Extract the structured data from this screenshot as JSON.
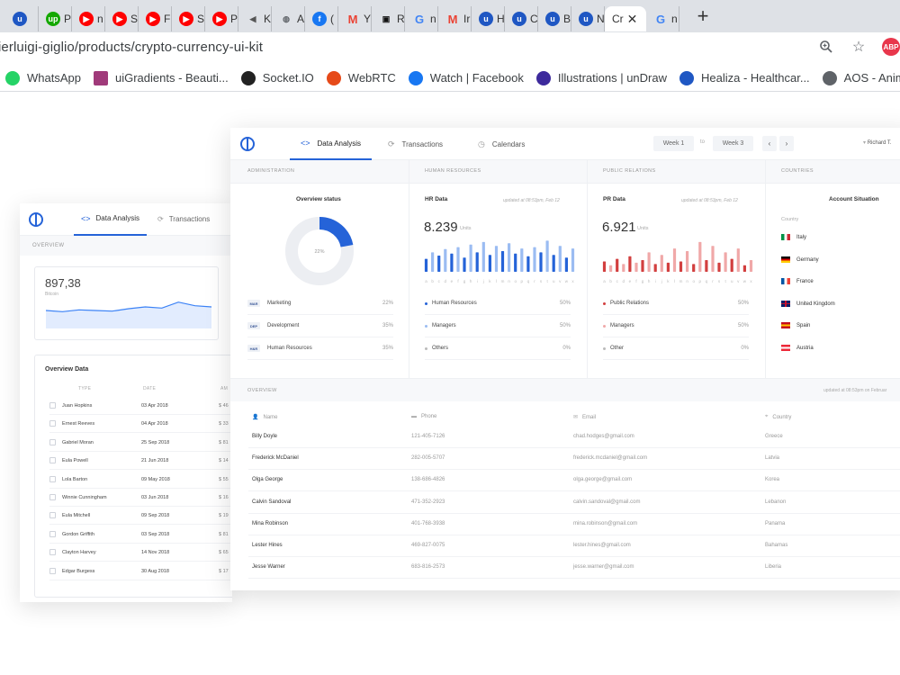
{
  "browser": {
    "tabs": [
      {
        "icon": "ui",
        "label": "",
        "color": "#1f57c3"
      },
      {
        "icon": "up",
        "label": "P",
        "color": "#14a800"
      },
      {
        "icon": "yt",
        "label": "n",
        "color": "#ff0000"
      },
      {
        "icon": "yt",
        "label": "S",
        "color": "#ff0000"
      },
      {
        "icon": "yt",
        "label": "F",
        "color": "#ff0000"
      },
      {
        "icon": "yt",
        "label": "S",
        "color": "#ff0000"
      },
      {
        "icon": "yt",
        "label": "P",
        "color": "#ff0000"
      },
      {
        "icon": "mute",
        "label": "Ki",
        "color": "#555555"
      },
      {
        "icon": "globe",
        "label": "A",
        "color": "#5f6368"
      },
      {
        "icon": "fb",
        "label": "(",
        "color": "#1877f2"
      },
      {
        "icon": "gm",
        "label": "Y",
        "color": "#ea4335"
      },
      {
        "icon": "qr",
        "label": "R",
        "color": "#111111"
      },
      {
        "icon": "g",
        "label": "n",
        "color": "#4285f4"
      },
      {
        "icon": "gm",
        "label": "Ir",
        "color": "#ea4335"
      },
      {
        "icon": "ui",
        "label": "H",
        "color": "#1f57c3"
      },
      {
        "icon": "ui",
        "label": "C",
        "color": "#1f57c3"
      },
      {
        "icon": "ui",
        "label": "B",
        "color": "#1f57c3"
      },
      {
        "icon": "ui",
        "label": "N",
        "color": "#1f57c3"
      }
    ],
    "active_tab": {
      "label": "Cr"
    },
    "last_tab": {
      "icon": "g",
      "label": "n",
      "color": "#4285f4"
    },
    "new_tab_label": "+",
    "url": "ierluigi-giglio/products/crypto-currency-ui-kit",
    "extension_badge": "ABP",
    "bookmarks": [
      {
        "label": "WhatsApp",
        "color": "#25d366"
      },
      {
        "label": "uiGradients - Beauti...",
        "color": "#a03a7a"
      },
      {
        "label": "Socket.IO",
        "color": "#222222"
      },
      {
        "label": "WebRTC",
        "color": "#e64a19"
      },
      {
        "label": "Watch | Facebook",
        "color": "#1877f2"
      },
      {
        "label": "Illustrations | unDraw",
        "color": "#3d2a9c"
      },
      {
        "label": "Healiza - Healthcar...",
        "color": "#1f57c3"
      },
      {
        "label": "AOS - Animate",
        "color": "#5f6368"
      }
    ]
  },
  "back_card": {
    "tabs": [
      {
        "label": "Data Analysis"
      },
      {
        "label": "Transactions"
      }
    ],
    "section": "OVERVIEW",
    "big_value": "897,38",
    "big_sub": "Bitcoin",
    "table_title": "Overview Data",
    "headers": [
      "TYPE",
      "DATE",
      "AM"
    ],
    "rows": [
      {
        "name": "Juan Hopkins",
        "date": "03 Apr 2018",
        "amount": "$ 46"
      },
      {
        "name": "Ernest Reeves",
        "date": "04 Apr 2018",
        "amount": "$ 33"
      },
      {
        "name": "Gabriel Moran",
        "date": "25 Sep 2018",
        "amount": "$ 81"
      },
      {
        "name": "Eula Powell",
        "date": "21 Jun 2018",
        "amount": "$ 14"
      },
      {
        "name": "Lola Barton",
        "date": "09 May 2018",
        "amount": "$ 55"
      },
      {
        "name": "Winnie Cunningham",
        "date": "03 Jun 2018",
        "amount": "$ 16"
      },
      {
        "name": "Eula Mitchell",
        "date": "09 Sep 2018",
        "amount": "$ 19"
      },
      {
        "name": "Gordon Griffith",
        "date": "03 Sep 2018",
        "amount": "$ 81"
      },
      {
        "name": "Clayton Harvey",
        "date": "14 Nov 2018",
        "amount": "$ 65"
      },
      {
        "name": "Edgar Burgess",
        "date": "30 Aug 2018",
        "amount": "$ 17"
      }
    ]
  },
  "front_card": {
    "tabs": [
      {
        "label": "Data Analysis"
      },
      {
        "label": "Transactions"
      },
      {
        "label": "Calendars"
      }
    ],
    "week_from": "Week 1",
    "week_sep": "to",
    "week_to": "Week 3",
    "user": "Richard T.",
    "sections": [
      "ADMINISTRATION",
      "HUMAN RESOURCES",
      "PUBLIC RELATIONS",
      "COUNTRIES"
    ],
    "overview_status": {
      "title": "Overview status",
      "center_label": "22%",
      "progress": 0.22,
      "legend": [
        {
          "badge": "MAR",
          "label": "Marketing",
          "pct": "22%"
        },
        {
          "badge": "DEP",
          "label": "Development",
          "pct": "35%"
        },
        {
          "badge": "H&R",
          "label": "Human Resources",
          "pct": "35%"
        }
      ]
    },
    "hr": {
      "title": "HR Data",
      "updated": "updated at 08:53pm, Feb 12",
      "value": "8.239",
      "units": "Units",
      "legend": [
        {
          "label": "Human Resources",
          "pct": "50%",
          "color": "#2563d8"
        },
        {
          "label": "Managers",
          "pct": "50%",
          "color": "#9bbcf2"
        },
        {
          "label": "Others",
          "pct": "0%",
          "color": "#bbbbbb"
        }
      ]
    },
    "pr": {
      "title": "PR Data",
      "updated": "updated at 08:53pm, Feb 12",
      "value": "6.921",
      "units": "Units",
      "legend": [
        {
          "label": "Public Relations",
          "pct": "50%",
          "color": "#d23f3f"
        },
        {
          "label": "Managers",
          "pct": "50%",
          "color": "#f0a8a8"
        },
        {
          "label": "Other",
          "pct": "0%",
          "color": "#bbbbbb"
        }
      ]
    },
    "countries": {
      "title": "Account Situation",
      "header": "Country",
      "items": [
        {
          "name": "Italy"
        },
        {
          "name": "Germany"
        },
        {
          "name": "France"
        },
        {
          "name": "United Kingdom"
        },
        {
          "name": "Spain"
        },
        {
          "name": "Austria"
        }
      ]
    },
    "overview": {
      "section": "OVERVIEW",
      "updated": "updated at 08:53pm on Februar",
      "headers": [
        "Name",
        "Phone",
        "Email",
        "Country"
      ],
      "rows": [
        {
          "name": "Billy Doyle",
          "phone": "121-405-7126",
          "email": "chad.hodges@gmail.com",
          "country": "Greece"
        },
        {
          "name": "Frederick McDaniel",
          "phone": "282-005-5707",
          "email": "frederick.mcdaniel@gmail.com",
          "country": "Latvia"
        },
        {
          "name": "Olga George",
          "phone": "138-686-4826",
          "email": "olga.george@gmail.com",
          "country": "Korea"
        },
        {
          "name": "Calvin Sandoval",
          "phone": "471-352-2923",
          "email": "calvin.sandoval@gmail.com",
          "country": "Lebanon"
        },
        {
          "name": "Mina Robinson",
          "phone": "401-768-3938",
          "email": "mina.robinson@gmail.com",
          "country": "Panama"
        },
        {
          "name": "Lester Hines",
          "phone": "469-827-0075",
          "email": "lester.hines@gmail.com",
          "country": "Bahamas"
        },
        {
          "name": "Jesse Warner",
          "phone": "683-816-2573",
          "email": "jesse.warner@gmail.com",
          "country": "Liberia"
        }
      ]
    }
  },
  "chart_data": [
    {
      "type": "bar",
      "categories": [
        "a",
        "b",
        "c",
        "d",
        "e",
        "f",
        "g",
        "h",
        "i",
        "j",
        "k",
        "l",
        "m",
        "n",
        "o",
        "p",
        "q",
        "r",
        "s",
        "t",
        "u",
        "v",
        "w",
        "x"
      ],
      "series": [
        {
          "values": [
            20,
            30,
            25,
            35,
            28,
            38,
            22,
            42,
            30,
            46,
            26,
            40,
            32,
            44,
            28,
            36,
            24,
            38,
            30,
            48,
            26,
            40,
            22,
            36
          ]
        }
      ],
      "ylim": [
        0,
        50
      ],
      "colors": [
        "#2563d8",
        "#9bbcf2"
      ]
    },
    {
      "type": "bar",
      "categories": [
        "a",
        "b",
        "c",
        "d",
        "e",
        "f",
        "g",
        "h",
        "i",
        "j",
        "k",
        "l",
        "m",
        "n",
        "o",
        "p",
        "q",
        "r",
        "s",
        "t",
        "u",
        "v",
        "w",
        "x"
      ],
      "series": [
        {
          "values": [
            16,
            10,
            20,
            12,
            24,
            14,
            18,
            30,
            12,
            26,
            14,
            36,
            16,
            32,
            12,
            46,
            18,
            40,
            14,
            30,
            20,
            36,
            10,
            18
          ]
        }
      ],
      "ylim": [
        0,
        50
      ],
      "colors": [
        "#d23f3f",
        "#f0a8a8"
      ]
    },
    {
      "type": "area",
      "x": [
        0,
        1,
        2,
        3,
        4,
        5,
        6,
        7,
        8,
        9,
        10
      ],
      "series": [
        {
          "values": [
            30,
            28,
            31,
            30,
            29,
            33,
            36,
            34,
            44,
            38,
            36
          ]
        }
      ],
      "ylim": [
        0,
        60
      ],
      "color": "#3b82f6"
    }
  ]
}
